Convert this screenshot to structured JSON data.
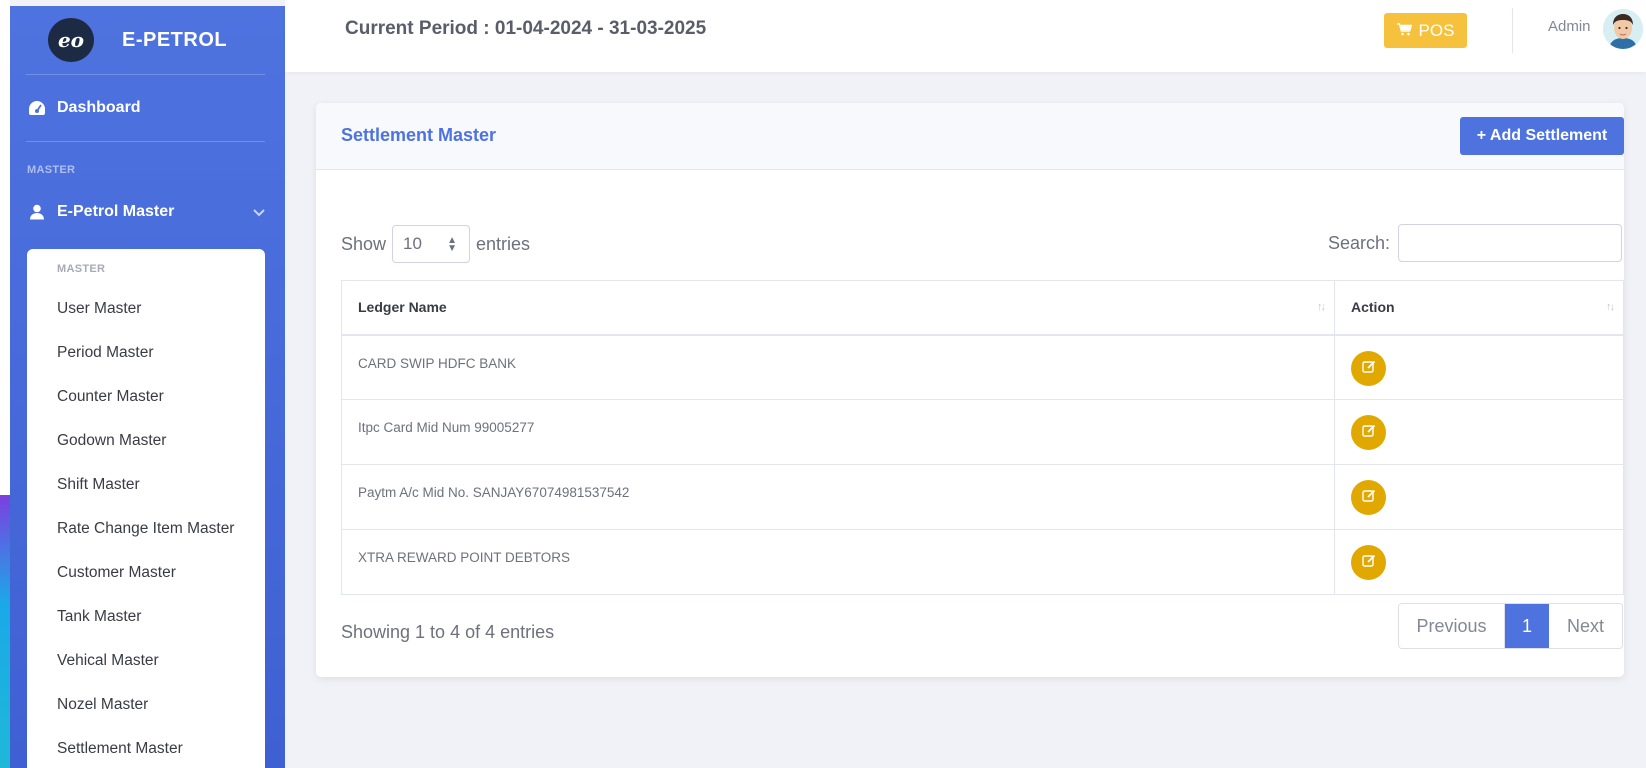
{
  "sidebar": {
    "brand": "E-PETROL",
    "logo_text": "eo",
    "dashboard_label": "Dashboard",
    "section_heading": "MASTER",
    "group_label": "E-Petrol Master",
    "submenu_heading": "MASTER",
    "submenu_items": [
      "User Master",
      "Period Master",
      "Counter Master",
      "Godown Master",
      "Shift Master",
      "Rate Change Item Master",
      "Customer Master",
      "Tank Master",
      "Vehical Master",
      "Nozel Master",
      "Settlement Master"
    ]
  },
  "topbar": {
    "period": "Current Period : 01-04-2024 - 31-03-2025",
    "pos_label": "POS",
    "user_name": "Admin"
  },
  "card": {
    "title": "Settlement Master",
    "add_button": "+ Add Settlement",
    "show_label": "Show",
    "entries_label": "entries",
    "page_length": "10",
    "search_label": "Search:",
    "search_value": "",
    "columns": [
      "Ledger Name",
      "Action"
    ],
    "rows": [
      "CARD SWIP HDFC BANK",
      "Itpc Card Mid Num 99005277",
      "Paytm A/c Mid No. SANJAY67074981537542",
      "XTRA REWARD POINT DEBTORS"
    ],
    "info": "Showing 1 to 4 of 4 entries",
    "pagination": {
      "previous": "Previous",
      "current": "1",
      "next": "Next"
    }
  },
  "colors": {
    "primary": "#4e73df",
    "warning": "#f6c23e",
    "edit": "#e0a800"
  }
}
